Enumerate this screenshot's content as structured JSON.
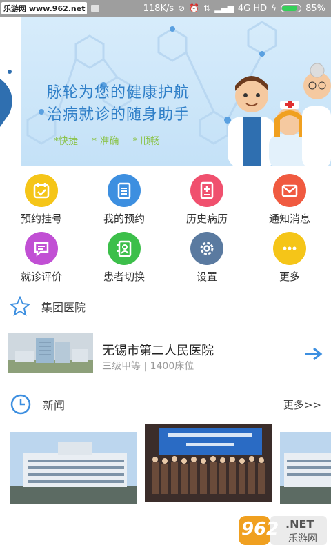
{
  "status": {
    "site_badge": "乐游网 www.962.net",
    "net_speed": "118K/s",
    "signal_text": "4G HD",
    "battery_pct": "85%",
    "battery_level": 0.85
  },
  "banner": {
    "line1": "脉轮为您的健康护航",
    "line2": "治病就诊的随身助手",
    "tags": [
      "*快捷",
      "* 准确",
      "* 顺畅"
    ],
    "active_dot": 1
  },
  "menu": [
    {
      "label": "预约挂号",
      "icon": "calendar-icon",
      "color": "#f5c518"
    },
    {
      "label": "我的预约",
      "icon": "clipboard-icon",
      "color": "#3d8fe0"
    },
    {
      "label": "历史病历",
      "icon": "medical-record-icon",
      "color": "#f0506e"
    },
    {
      "label": "通知消息",
      "icon": "mail-icon",
      "color": "#f05a40"
    },
    {
      "label": "就诊评价",
      "icon": "comment-icon",
      "color": "#c14fd4"
    },
    {
      "label": "患者切换",
      "icon": "contacts-icon",
      "color": "#3cbf4a"
    },
    {
      "label": "设置",
      "icon": "gear-icon",
      "color": "#5a7aa0"
    },
    {
      "label": "更多",
      "icon": "more-icon",
      "color": "#f5c518"
    }
  ],
  "group": {
    "title": "集团医院",
    "hospital_name": "无锡市第二人民医院",
    "hospital_sub": "三级甲等 | 1400床位"
  },
  "news": {
    "title": "新闻",
    "more": "更多>>"
  },
  "watermark": {
    "brand": "962",
    "suffix": ".NET",
    "name": "乐游网"
  }
}
